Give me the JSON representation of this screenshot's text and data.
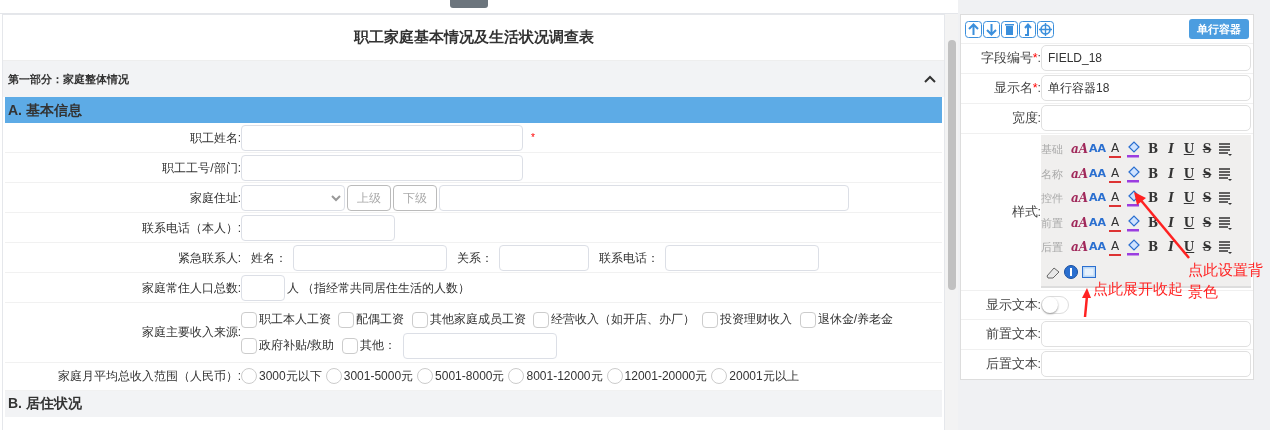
{
  "form": {
    "title": "职工家庭基本情况及生活状况调查表",
    "section": {
      "title": "第一部分：家庭整体情况",
      "expanded": true
    },
    "groups": [
      {
        "title": "A. 基本信息",
        "selected": true,
        "fields": [
          {
            "kind": "text",
            "label": "职工姓名:",
            "required_mark": "*"
          },
          {
            "kind": "text",
            "label": "职工工号/部门:"
          },
          {
            "kind": "address",
            "label": "家庭住址:",
            "buttons": [
              {
                "label": "上级",
                "disabled": true
              },
              {
                "label": "下级",
                "disabled": true
              }
            ]
          },
          {
            "kind": "phone",
            "label": "联系电话（本人）:"
          },
          {
            "kind": "contact",
            "label": "紧急联系人:",
            "parts": [
              "姓名：",
              "关系：",
              "联系电话："
            ]
          },
          {
            "kind": "count",
            "label": "家庭常住人口总数:",
            "suffix": "人 （指经常共同居住生活的人数）"
          },
          {
            "kind": "checkboxes",
            "label": "家庭主要收入来源:",
            "options": [
              {
                "label": "职工本人工资",
                "checked": false
              },
              {
                "label": "配偶工资",
                "checked": false
              },
              {
                "label": "其他家庭成员工资",
                "checked": false
              },
              {
                "label": "经营收入（如开店、办厂）",
                "checked": false
              },
              {
                "label": "投资理财收入",
                "checked": false
              },
              {
                "label": "退休金/养老金",
                "checked": false
              },
              {
                "label": "政府补贴/救助",
                "checked": false
              },
              {
                "label": "其他：",
                "checked": false
              }
            ]
          },
          {
            "kind": "radios",
            "label": "家庭月平均总收入范围（人民币）:",
            "options": [
              {
                "label": "3000元以下",
                "selected": false
              },
              {
                "label": "3001-5000元",
                "selected": false
              },
              {
                "label": "5001-8000元",
                "selected": false
              },
              {
                "label": "8001-12000元",
                "selected": false
              },
              {
                "label": "12001-20000元",
                "selected": false
              },
              {
                "label": "20001元以上",
                "selected": false
              }
            ]
          }
        ]
      },
      {
        "title": "B. 居住状况",
        "selected": false
      }
    ]
  },
  "properties": {
    "type_button": "单行容器",
    "rows": [
      {
        "kind": "input",
        "label": "字段编号",
        "required_mark": "*",
        "label_end": ":",
        "value": "FIELD_18"
      },
      {
        "kind": "input",
        "label": "显示名",
        "required_mark": "*",
        "label_end": ":",
        "value": "单行容器18"
      },
      {
        "kind": "input",
        "label": "宽度:"
      },
      {
        "kind": "style",
        "label": "样式:",
        "style_rows": [
          {
            "label": "基础",
            "tools": [
              "aA",
              "AA",
              "A",
              "B",
              "I",
              "U",
              "S"
            ]
          },
          {
            "label": "名称",
            "tools": [
              "aA",
              "AA",
              "A",
              "B",
              "I",
              "U",
              "S"
            ]
          },
          {
            "label": "控件",
            "tools": [
              "aA",
              "AA",
              "A",
              "B",
              "I",
              "U",
              "S"
            ]
          },
          {
            "label": "前置",
            "tools": [
              "aA",
              "AA",
              "A",
              "B",
              "I",
              "U",
              "S"
            ]
          },
          {
            "label": "后置",
            "tools": [
              "aA",
              "AA",
              "A",
              "B",
              "I",
              "U",
              "S"
            ]
          }
        ]
      },
      {
        "kind": "toggle",
        "label": "显示文本:",
        "on": false
      },
      {
        "kind": "input",
        "label": "前置文本:"
      },
      {
        "kind": "input",
        "label": "后置文本:"
      }
    ]
  },
  "annotations": [
    {
      "text": "点此展开收起"
    },
    {
      "text": "点此设置背景色"
    }
  ]
}
